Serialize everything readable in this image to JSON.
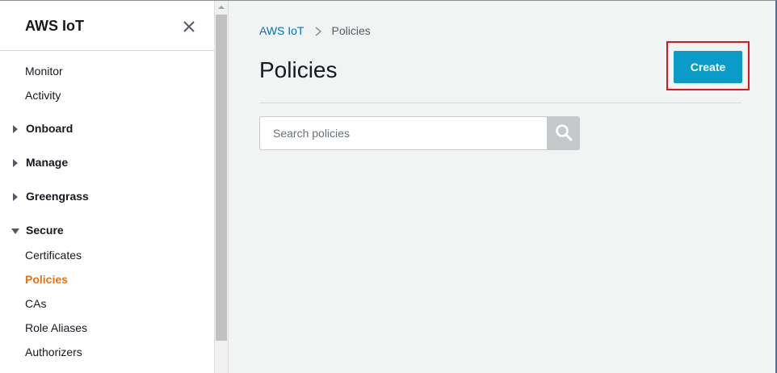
{
  "sidebar": {
    "title": "AWS IoT",
    "items": [
      {
        "label": "Monitor",
        "type": "link"
      },
      {
        "label": "Activity",
        "type": "link"
      },
      {
        "label": "Onboard",
        "type": "group",
        "expanded": false
      },
      {
        "label": "Manage",
        "type": "group",
        "expanded": false
      },
      {
        "label": "Greengrass",
        "type": "group",
        "expanded": false
      },
      {
        "label": "Secure",
        "type": "group",
        "expanded": true
      },
      {
        "label": "Certificates",
        "type": "link"
      },
      {
        "label": "Policies",
        "type": "link",
        "active": true
      },
      {
        "label": "CAs",
        "type": "link"
      },
      {
        "label": "Role Aliases",
        "type": "link"
      },
      {
        "label": "Authorizers",
        "type": "link"
      }
    ]
  },
  "breadcrumb": {
    "root": "AWS IoT",
    "current": "Policies"
  },
  "main": {
    "title": "Policies",
    "create_label": "Create",
    "search_placeholder": "Search policies"
  },
  "colors": {
    "accent_link": "#0073bb",
    "active_nav": "#ec7211",
    "primary_button": "#0a9bc9",
    "highlight_border": "#e1141b"
  }
}
